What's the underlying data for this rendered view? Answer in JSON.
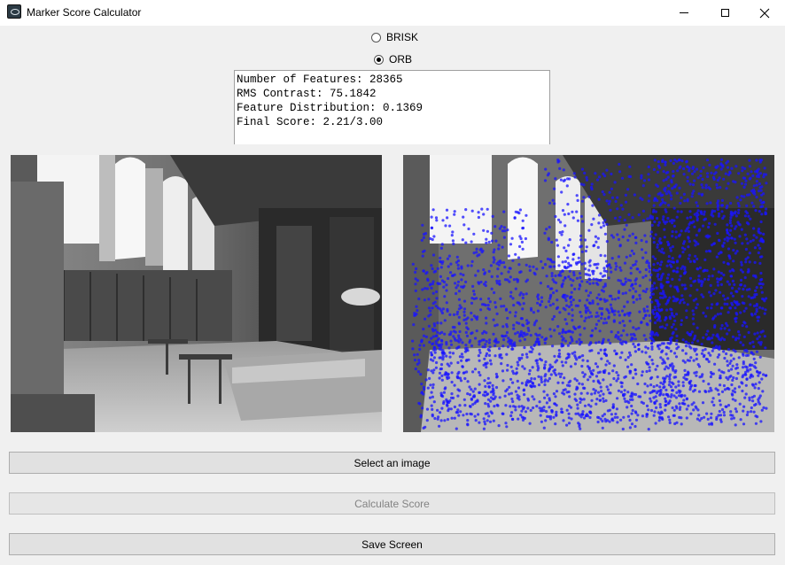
{
  "window": {
    "title": "Marker Score Calculator",
    "icon": "app-icon"
  },
  "detector": {
    "options": [
      "BRISK",
      "ORB"
    ],
    "selected": "ORB"
  },
  "stats": {
    "lines": [
      "Number of Features: 28365",
      "RMS Contrast: 75.1842",
      "Feature Distribution: 0.1369",
      "Final Score: 2.21/3.00"
    ]
  },
  "images": {
    "original_desc": "grayscale library interior",
    "features_color": "#1a14ff"
  },
  "buttons": {
    "select_image": "Select an image",
    "calculate_score": "Calculate Score",
    "save_screen": "Save Screen"
  },
  "state": {
    "calculate_enabled": false
  }
}
